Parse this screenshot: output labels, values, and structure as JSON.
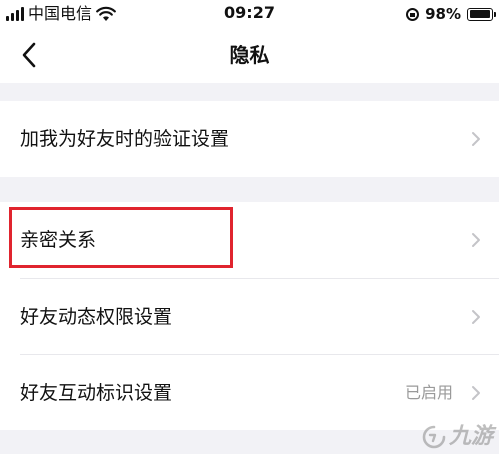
{
  "status_bar": {
    "carrier": "中国电信",
    "time": "09:27",
    "battery_percent": "98%",
    "battery_level": 0.98,
    "icons": [
      "signal-icon",
      "wifi-icon",
      "rotation-lock-icon",
      "battery-icon"
    ]
  },
  "nav": {
    "title": "隐私",
    "back_icon": "chevron-left-icon"
  },
  "groups": [
    {
      "items": [
        {
          "label": "加我为好友时的验证设置",
          "value": ""
        }
      ]
    },
    {
      "items": [
        {
          "label": "亲密关系",
          "value": "",
          "highlighted": true
        },
        {
          "label": "好友动态权限设置",
          "value": ""
        },
        {
          "label": "好友互动标识设置",
          "value": "已启用"
        }
      ]
    }
  ],
  "watermark": {
    "text": "九游",
    "icon": "jiuyou-logo-icon"
  },
  "colors": {
    "background": "#f2f2f6",
    "surface": "#ffffff",
    "highlight": "#e0242e",
    "chevron": "#c4c4c8",
    "secondary_text": "#9a9a9a"
  }
}
